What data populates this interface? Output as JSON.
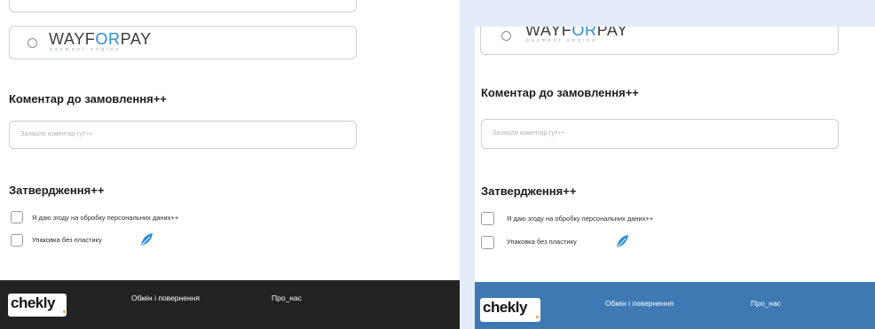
{
  "payment": {
    "logo_prefix": "WAYF",
    "logo_mid": "OR",
    "logo_suffix": "PAY",
    "logo_tagline": "payment engine"
  },
  "comment": {
    "heading": "Коментар до замовлення++",
    "placeholder": "Залиште коментар тут++"
  },
  "confirmation": {
    "heading": "Затвердження++",
    "consent_label": "Я даю згоду на обробку персональних даних++",
    "packaging_label": "Упаковка без пластику"
  },
  "footer": {
    "brand": "chekly",
    "links": [
      "Обмін і повернення",
      "Про_нас"
    ]
  },
  "colors": {
    "footer_left": "#222222",
    "footer_right": "#3e79b3",
    "accent_blue": "#2a8fd8",
    "brand_dot": "#f2a125"
  },
  "icons": {
    "leaf": "leaf-icon"
  }
}
